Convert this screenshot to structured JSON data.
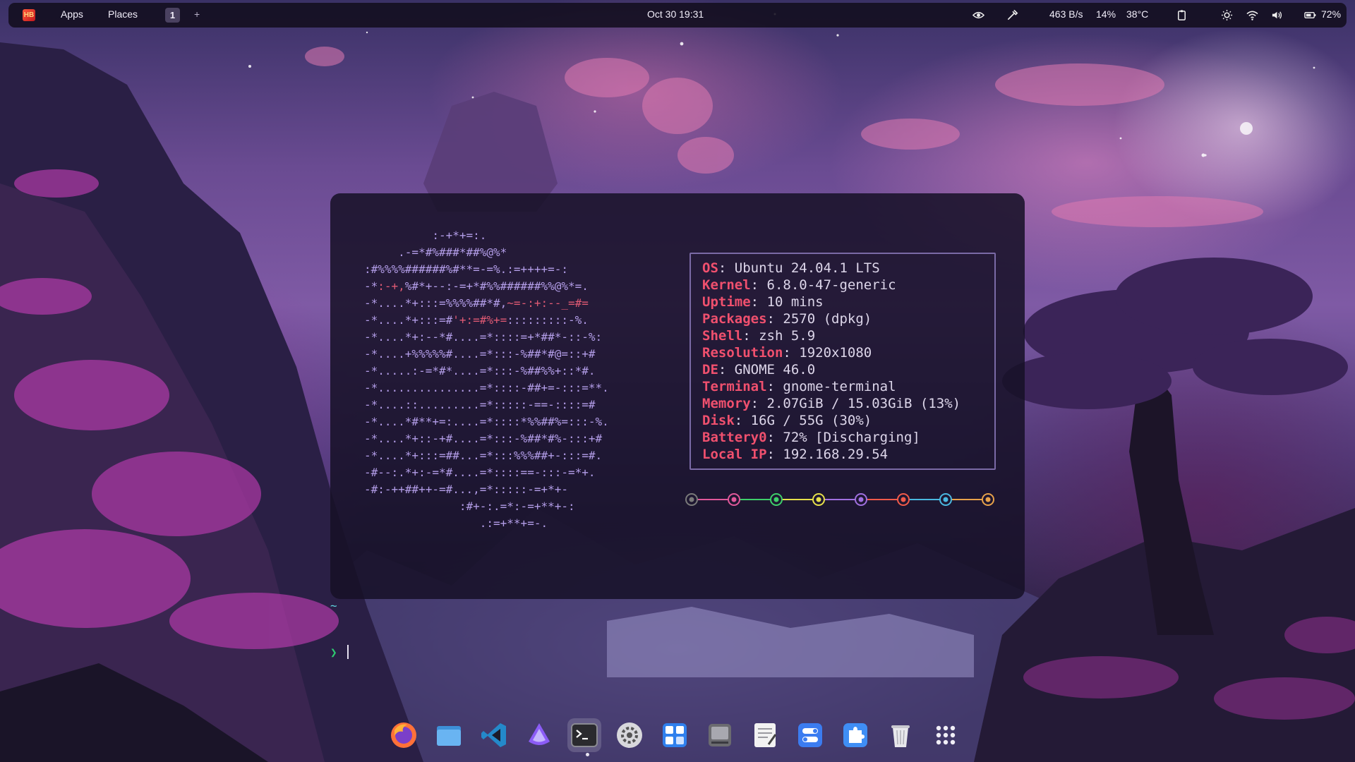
{
  "topbar": {
    "logo_icon": "ubuntu-logo-icon",
    "apps_label": "Apps",
    "places_label": "Places",
    "workspace_active": "1",
    "workspace_add": "+",
    "clock": "Oct 30  19:31",
    "net_speed": "463 B/s",
    "cpu": "14%",
    "temp": "38°C",
    "battery": "72%",
    "icons": [
      "eye-icon",
      "color-picker-icon",
      "clipboard-icon",
      "brightness-icon",
      "wifi-icon",
      "volume-icon",
      "battery-icon"
    ]
  },
  "terminal": {
    "info": [
      {
        "key": "OS",
        "value": "Ubuntu 24.04.1 LTS"
      },
      {
        "key": "Kernel",
        "value": "6.8.0-47-generic"
      },
      {
        "key": "Uptime",
        "value": "10 mins"
      },
      {
        "key": "Packages",
        "value": "2570 (dpkg)"
      },
      {
        "key": "Shell",
        "value": "zsh 5.9"
      },
      {
        "key": "Resolution",
        "value": "1920x1080"
      },
      {
        "key": "DE",
        "value": "GNOME 46.0"
      },
      {
        "key": "Terminal",
        "value": "gnome-terminal"
      },
      {
        "key": "Memory",
        "value": "2.07GiB / 15.03GiB (13%)"
      },
      {
        "key": "Disk",
        "value": "16G / 55G (30%)"
      },
      {
        "key": "Battery0",
        "value": "72% [Discharging]"
      },
      {
        "key": "Local IP",
        "value": "192.168.29.54"
      }
    ],
    "palette": [
      "#7a7a7a",
      "#e0589a",
      "#3ecf6a",
      "#e6e04a",
      "#a070e0",
      "#f05a4a",
      "#4ab8e0",
      "#e8a24a"
    ],
    "prompt_dir": "~",
    "prompt_symbol": "❯"
  },
  "dock": {
    "items": [
      "firefox-icon",
      "files-icon",
      "vscode-icon",
      "proton-vpn-icon",
      "terminal-icon",
      "settings-icon",
      "calculator-icon",
      "disks-icon",
      "text-editor-icon",
      "tweaks-icon",
      "extensions-icon",
      "trash-icon",
      "show-apps-icon"
    ]
  }
}
